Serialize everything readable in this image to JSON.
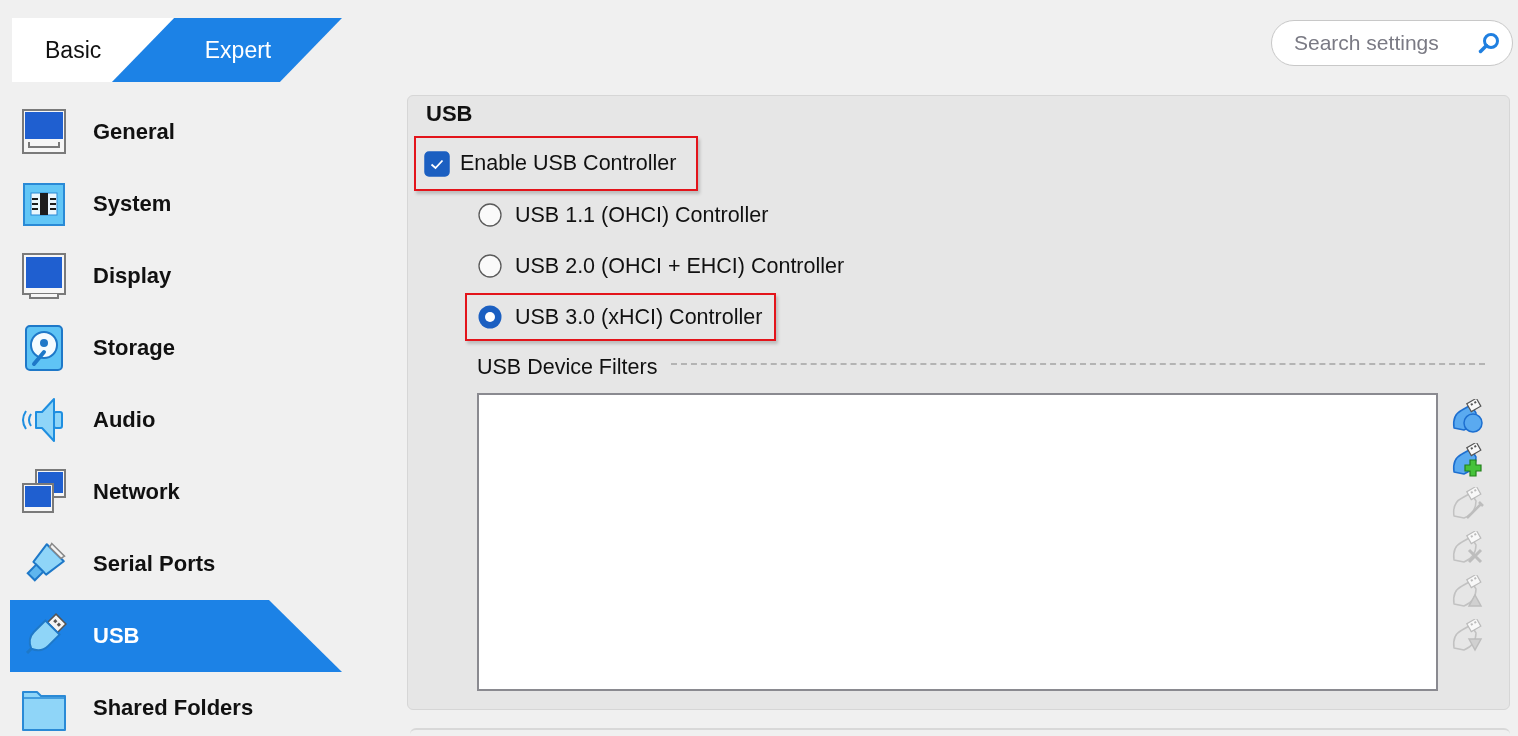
{
  "mode_tabs": [
    {
      "label": "Basic",
      "selected": false
    },
    {
      "label": "Expert",
      "selected": true
    }
  ],
  "search": {
    "placeholder": "Search settings"
  },
  "sidebar": {
    "items": [
      {
        "kind": "general",
        "label": "General",
        "selected": false
      },
      {
        "kind": "system",
        "label": "System",
        "selected": false
      },
      {
        "kind": "display",
        "label": "Display",
        "selected": false
      },
      {
        "kind": "storage",
        "label": "Storage",
        "selected": false
      },
      {
        "kind": "audio",
        "label": "Audio",
        "selected": false
      },
      {
        "kind": "network",
        "label": "Network",
        "selected": false
      },
      {
        "kind": "serial",
        "label": "Serial Ports",
        "selected": false
      },
      {
        "kind": "usb",
        "label": "USB",
        "selected": true
      },
      {
        "kind": "shared",
        "label": "Shared Folders",
        "selected": false
      }
    ]
  },
  "page": {
    "title": "USB",
    "enable": {
      "label": "Enable USB Controller",
      "checked": true,
      "highlighted": true
    },
    "controllers": [
      {
        "label": "USB 1.1 (OHCI) Controller",
        "selected": false,
        "highlighted": false
      },
      {
        "label": "USB 2.0 (OHCI + EHCI) Controller",
        "selected": false,
        "highlighted": false
      },
      {
        "label": "USB 3.0 (xHCI) Controller",
        "selected": true,
        "highlighted": true
      }
    ],
    "filters": {
      "title": "USB Device Filters",
      "tools": [
        {
          "kind": "new",
          "disabled": false
        },
        {
          "kind": "add",
          "disabled": false
        },
        {
          "kind": "edit",
          "disabled": true
        },
        {
          "kind": "remove",
          "disabled": true
        },
        {
          "kind": "up",
          "disabled": true
        },
        {
          "kind": "down",
          "disabled": true
        }
      ]
    }
  }
}
